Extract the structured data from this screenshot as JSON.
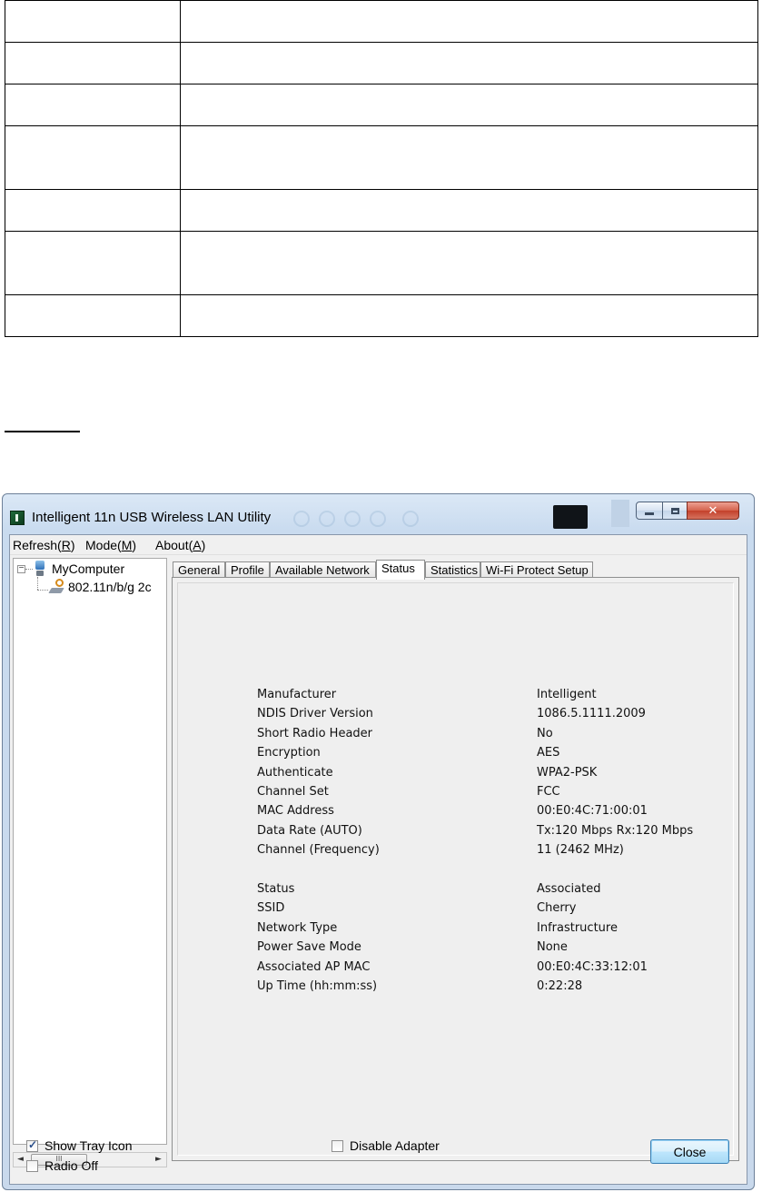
{
  "window": {
    "title": "Intelligent 11n USB Wireless LAN Utility"
  },
  "menu": [
    {
      "text": "Refresh(",
      "key": "R",
      "tail": ")"
    },
    {
      "text": "Mode(",
      "key": "M",
      "tail": ")"
    },
    {
      "text": "About(",
      "key": "A",
      "tail": ")"
    }
  ],
  "tree": {
    "root": "MyComputer",
    "toggle": "−",
    "child": "802.11n/b/g 2c"
  },
  "scrollbar": {
    "left": "◄",
    "right": "►",
    "thumb": "III"
  },
  "tabs": [
    "General",
    "Profile",
    "Available Network",
    "Status",
    "Statistics",
    "Wi-Fi Protect Setup"
  ],
  "active_tab": "Status",
  "status": {
    "group1": [
      {
        "label": "Manufacturer",
        "value": "Intelligent"
      },
      {
        "label": "NDIS Driver Version",
        "value": "1086.5.1111.2009"
      },
      {
        "label": "Short Radio Header",
        "value": "No"
      },
      {
        "label": "Encryption",
        "value": "AES"
      },
      {
        "label": "Authenticate",
        "value": "WPA2-PSK"
      },
      {
        "label": "Channel Set",
        "value": "FCC"
      },
      {
        "label": "MAC Address",
        "value": "00:E0:4C:71:00:01"
      },
      {
        "label": "Data Rate (AUTO)",
        "value": "Tx:120 Mbps Rx:120 Mbps"
      },
      {
        "label": "Channel (Frequency)",
        "value": "11 (2462 MHz)"
      }
    ],
    "group2": [
      {
        "label": "Status",
        "value": "Associated"
      },
      {
        "label": "SSID",
        "value": "Cherry"
      },
      {
        "label": "Network Type",
        "value": "Infrastructure"
      },
      {
        "label": "Power Save Mode",
        "value": "None"
      },
      {
        "label": "Associated AP MAC",
        "value": "00:E0:4C:33:12:01"
      },
      {
        "label": "Up Time (hh:mm:ss)",
        "value": "0:22:28"
      }
    ]
  },
  "bottom": {
    "show_tray_icon": {
      "label": "Show Tray Icon",
      "checked": true
    },
    "radio_off": {
      "label": "Radio Off",
      "checked": false
    },
    "disable_adapter": {
      "label": "Disable Adapter",
      "checked": false
    },
    "close_label": "Close"
  },
  "checkmark": "✓",
  "close_glyph": "✕",
  "colors": {
    "window_frame": "#c9dbef",
    "close_button": "#c4402a",
    "checkbox_tick": "#2a4f8a"
  }
}
